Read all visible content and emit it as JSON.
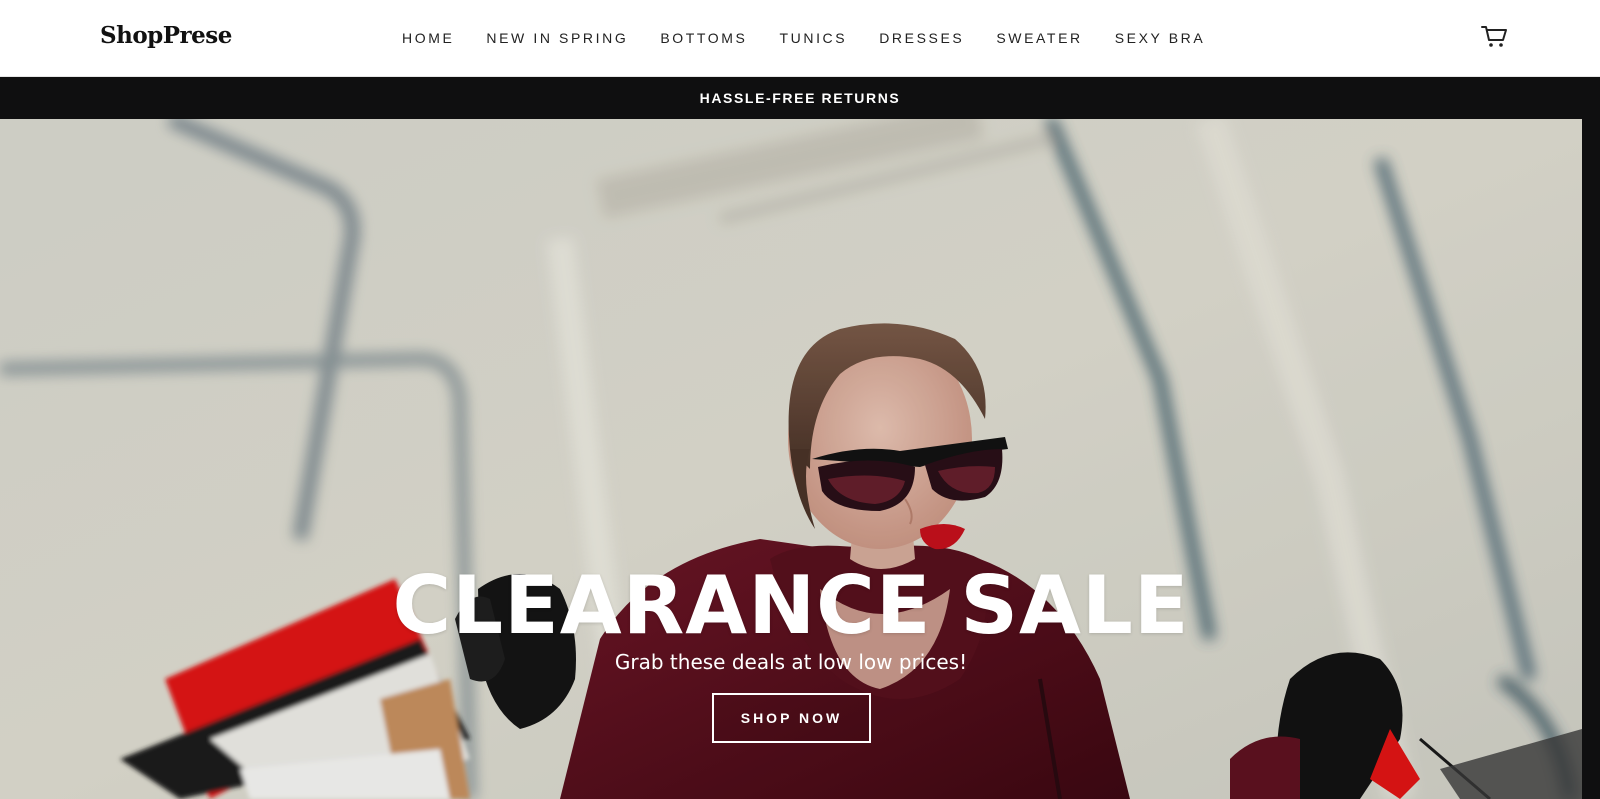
{
  "header": {
    "logo": "ShopPrese",
    "nav": [
      "HOME",
      "NEW IN SPRING",
      "BOTTOMS",
      "TUNICS",
      "DRESSES",
      "SWEATER",
      "SEXY BRA"
    ],
    "cart_icon": "cart-icon"
  },
  "announcement": {
    "text": "HASSLE-FREE RETURNS"
  },
  "hero": {
    "title": "CLEARANCE SALE",
    "subtitle": "Grab these deals at low low prices!",
    "button_label": "SHOP NOW"
  },
  "colors": {
    "header_bg": "#ffffff",
    "announcement_bg": "#0f0f10",
    "hero_text": "#ffffff",
    "coat": "#5e1120",
    "lips": "#c4101c",
    "bag_red": "#e01515"
  }
}
